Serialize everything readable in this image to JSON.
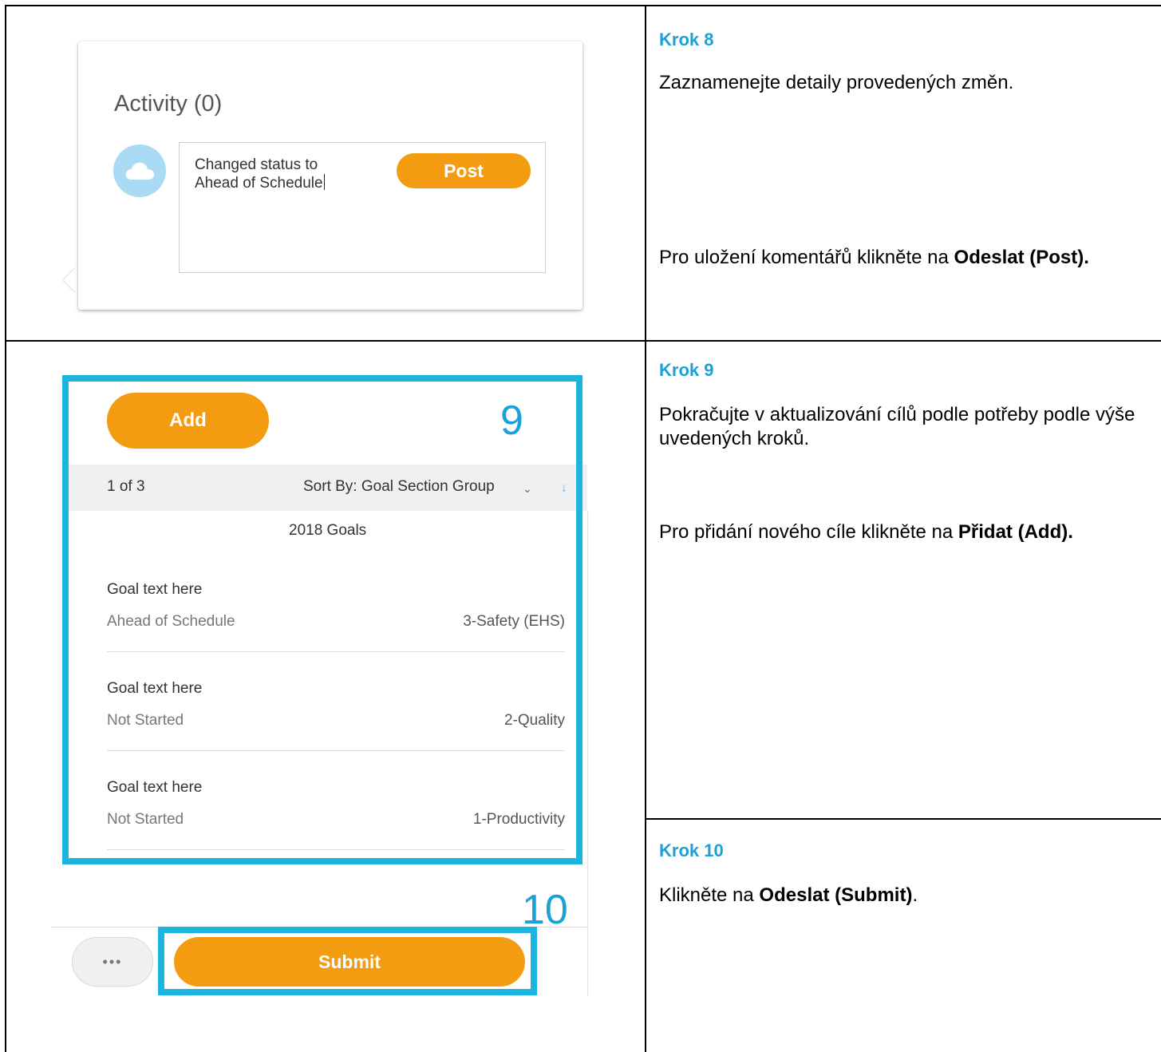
{
  "steps": [
    {
      "title": "Krok 8",
      "line1": "Zaznamenejte detaily provedených změn.",
      "line2_prefix": "Pro uložení komentářů klikněte na ",
      "line2_bold": "Odeslat (Post)."
    },
    {
      "title": "Krok 9",
      "line1": "Pokračujte v aktualizování cílů podle potřeby podle výše uvedených kroků.",
      "line2_prefix": "Pro přidání nového cíle klikněte na ",
      "line2_bold": "Přidat (Add)."
    },
    {
      "title": "Krok 10",
      "line1_prefix": "Klikněte na ",
      "line1_bold": "Odeslat (Submit)",
      "line1_suffix": "."
    }
  ],
  "activity": {
    "title": "Activity (0)",
    "comment_line1": "Changed status to",
    "comment_line2": "Ahead of Schedule",
    "post_label": "Post",
    "avatar_icon": "cloud-icon"
  },
  "goals_panel": {
    "add_label": "Add",
    "callout_9": "9",
    "callout_10": "10",
    "page_count": "1 of 3",
    "sort_label": "Sort By: Goal Section Group",
    "group_label": "2018 Goals",
    "goals": [
      {
        "name": "Goal text here",
        "status": "Ahead of Schedule",
        "category": "3-Safety (EHS)"
      },
      {
        "name": "Goal text here",
        "status": "Not Started",
        "category": "2-Quality"
      },
      {
        "name": "Goal text here",
        "status": "Not Started",
        "category": "1-Productivity"
      }
    ],
    "more_label": "•••",
    "submit_label": "Submit"
  },
  "colors": {
    "accent_blue": "#1aa1d7",
    "highlight_blue": "#1eb4e0",
    "button_orange": "#f39c12"
  }
}
